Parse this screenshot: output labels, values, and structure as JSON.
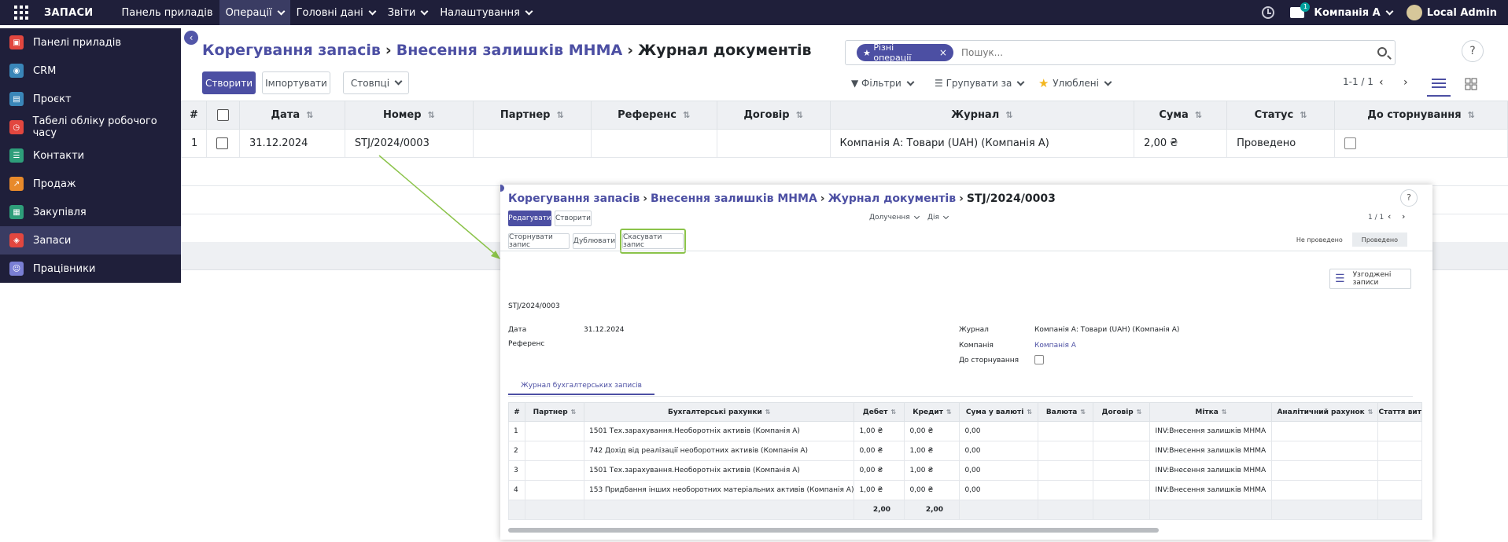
{
  "navbar": {
    "app_name": "ЗАПАСИ",
    "menu": [
      "Панель приладів",
      "Операції",
      "Головні дані",
      "Звіти",
      "Налаштування"
    ],
    "notification_count": "1",
    "company": "Компанія А",
    "user": "Local Admin"
  },
  "sidebar": {
    "items": [
      {
        "label": "Панелі приладів",
        "icon": "dashboard-icon",
        "color": "#e2473f"
      },
      {
        "label": "CRM",
        "icon": "crm-icon",
        "color": "#3a86b8"
      },
      {
        "label": "Проєкт",
        "icon": "project-icon",
        "color": "#3a86b8"
      },
      {
        "label": "Табелі обліку робочого часу",
        "icon": "timesheet-icon",
        "color": "#e2473f"
      },
      {
        "label": "Контакти",
        "icon": "contacts-icon",
        "color": "#2e9e7a"
      },
      {
        "label": "Продаж",
        "icon": "sales-icon",
        "color": "#e88a2b"
      },
      {
        "label": "Закупівля",
        "icon": "purchase-icon",
        "color": "#2e9e7a"
      },
      {
        "label": "Запаси",
        "icon": "inventory-icon",
        "color": "#e2473f"
      },
      {
        "label": "Працівники",
        "icon": "employees-icon",
        "color": "#7a7fd4"
      }
    ]
  },
  "list": {
    "breadcrumb": [
      "Корегування запасів",
      "Внесення залишків МНМА",
      "Журнал документів"
    ],
    "search_facet": "Різні операції",
    "search_placeholder": "Пошук...",
    "buttons": {
      "create": "Створити",
      "import": "Імпортувати",
      "columns": "Стовпці"
    },
    "controls": {
      "filters": "Фільтри",
      "group_by": "Групувати за",
      "favorites": "Улюблені"
    },
    "pager": "1-1 / 1",
    "columns": [
      "#",
      "",
      "Дата",
      "Номер",
      "Партнер",
      "Референс",
      "Договір",
      "Журнал",
      "Сума",
      "Статус",
      "До сторнування"
    ],
    "rows": [
      {
        "num": "1",
        "date": "31.12.2024",
        "number": "STJ/2024/0003",
        "partner": "",
        "ref": "",
        "contract": "",
        "journal": "Компанія А: Товари (UAH) (Компанія А)",
        "amount": "2,00 ₴",
        "status": "Проведено"
      }
    ]
  },
  "form": {
    "breadcrumb": [
      "Корегування запасів",
      "Внесення залишків МНМА",
      "Журнал документів",
      "STJ/2024/0003"
    ],
    "buttons": {
      "edit": "Редагувати",
      "create": "Створити",
      "reverse": "Сторнувати запис",
      "duplicate": "Дублювати",
      "cancel": "Скасувати запис"
    },
    "controls": {
      "attachments": "Долучення",
      "action": "Дія"
    },
    "pager": "1 / 1",
    "status": {
      "draft": "Не проведено",
      "posted": "Проведено"
    },
    "matched_entries": "Узгоджені записи",
    "name": "STJ/2024/0003",
    "fields": {
      "date_label": "Дата",
      "date": "31.12.2024",
      "ref_label": "Референс",
      "journal_label": "Журнал",
      "journal": "Компанія А: Товари (UAH) (Компанія А)",
      "company_label": "Компанія",
      "company": "Компанія А",
      "reverse_label": "До сторнування"
    },
    "tab": "Журнал бухгалтерських записів",
    "columns": [
      "#",
      "Партнер",
      "Бухгалтерські рахунки",
      "Дебет",
      "Кредит",
      "Сума у валюті",
      "Валюта",
      "Договір",
      "Мітка",
      "Аналітичний рахунок",
      "Стаття вит"
    ],
    "lines": [
      {
        "num": "1",
        "account": "1501 Тех.зарахування.Необоротніх активів (Компанія А)",
        "debit": "1,00 ₴",
        "credit": "0,00 ₴",
        "amount_currency": "0,00",
        "label": "INV:Внесення залишків МНМА"
      },
      {
        "num": "2",
        "account": "742 Дохід від реалізації необоротних активів (Компанія А)",
        "debit": "0,00 ₴",
        "credit": "1,00 ₴",
        "amount_currency": "0,00",
        "label": "INV:Внесення залишків МНМА"
      },
      {
        "num": "3",
        "account": "1501 Тех.зарахування.Необоротніх активів (Компанія А)",
        "debit": "0,00 ₴",
        "credit": "1,00 ₴",
        "amount_currency": "0,00",
        "label": "INV:Внесення залишків МНМА"
      },
      {
        "num": "4",
        "account": "153 Придбання інших необоротних матеріальних активів (Компанія А)",
        "debit": "1,00 ₴",
        "credit": "0,00 ₴",
        "amount_currency": "0,00",
        "label": "INV:Внесення залишків МНМА"
      }
    ],
    "totals": {
      "debit": "2,00",
      "credit": "2,00"
    }
  },
  "colors": {
    "navbar": "#1f1f3a",
    "accent": "#4c4fa3",
    "highlight": "#8bc34a"
  }
}
